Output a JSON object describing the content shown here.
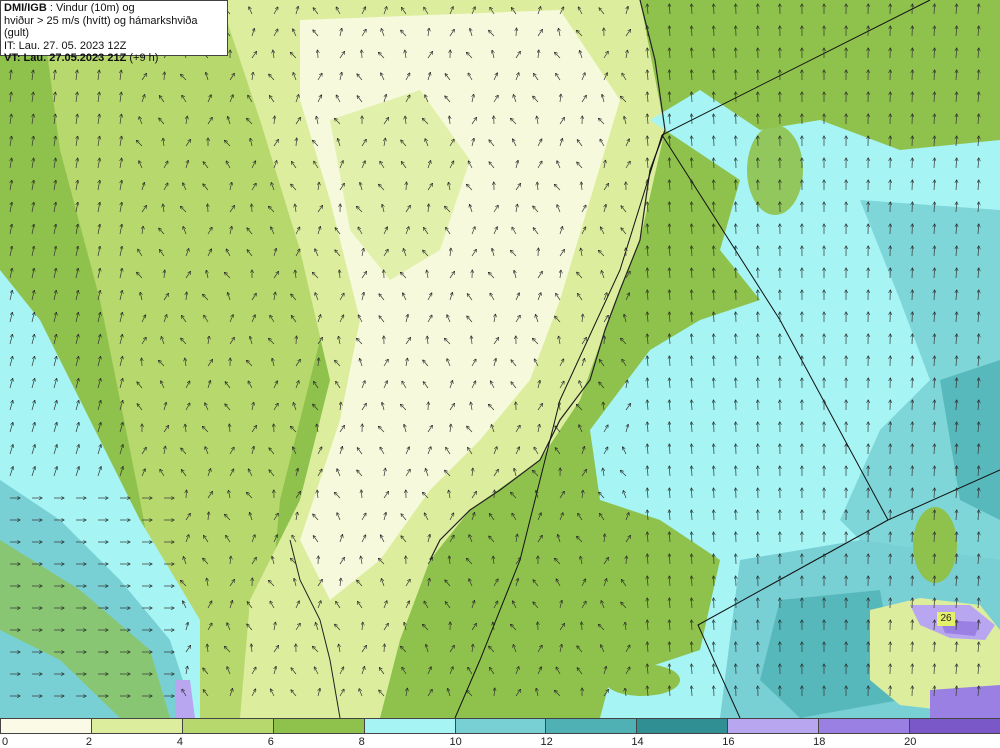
{
  "info": {
    "source": "DMI/IGB",
    "line1_rest": " : Vindur (10m) og",
    "line2": "hviður > 25 m/s (hvítt) og hámarkshviða (gult)",
    "line3": "IT: Lau. 27. 05. 2023 12Z",
    "line4_bold": "VT: Lau. 27.05.2023 21Z",
    "line4_rest": " (+9 h)"
  },
  "gust_label": "26",
  "colors": {
    "c0": "#fafae6",
    "c2": "#dcee9e",
    "c4": "#b6d86c",
    "c6": "#8fc24c",
    "c8": "#a6f4f4",
    "c10": "#78d0d4",
    "c12": "#4fb1b4",
    "c14": "#2f8f92",
    "c16": "#b8a6f0",
    "c18": "#9a80e2",
    "c20": "#7a58c8"
  },
  "legend": {
    "ticks": [
      "0",
      "2",
      "4",
      "6",
      "8",
      "10",
      "12",
      "14",
      "16",
      "18",
      "20"
    ]
  }
}
